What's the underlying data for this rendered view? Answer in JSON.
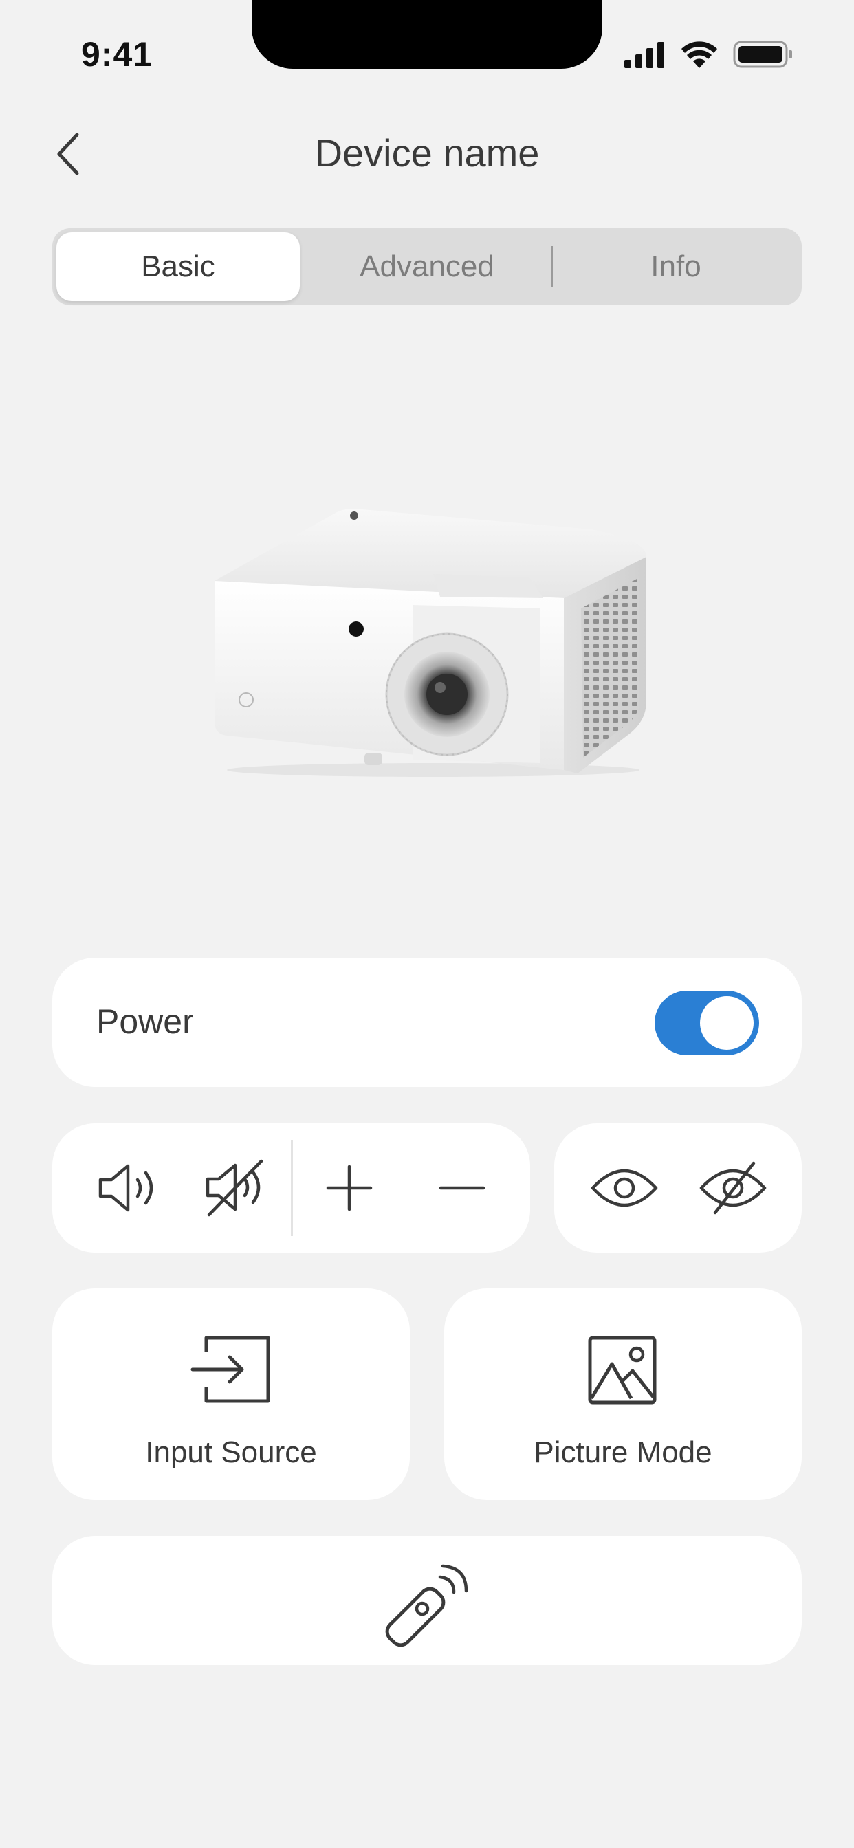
{
  "status_bar": {
    "time": "9:41"
  },
  "header": {
    "title": "Device name"
  },
  "tabs": [
    {
      "label": "Basic",
      "active": true
    },
    {
      "label": "Advanced",
      "active": false
    },
    {
      "label": "Info",
      "active": false
    }
  ],
  "power": {
    "label": "Power",
    "on": true,
    "accent": "#2a7fd4"
  },
  "controls": {
    "volume_up_icon": "speaker-volume-icon",
    "mute_icon": "speaker-mute-icon",
    "plus_icon": "plus-icon",
    "minus_icon": "minus-icon",
    "show_icon": "eye-icon",
    "hide_icon": "eye-off-icon"
  },
  "tiles": [
    {
      "label": "Input Source",
      "icon": "input-source-icon"
    },
    {
      "label": "Picture Mode",
      "icon": "picture-icon"
    }
  ],
  "remote": {
    "icon": "remote-control-icon"
  }
}
